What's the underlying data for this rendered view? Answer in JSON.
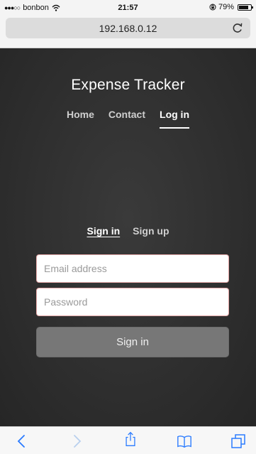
{
  "status_bar": {
    "carrier": "bonbon",
    "signal_dots": "●●●○○",
    "time": "21:57",
    "battery_percent": "79%",
    "battery_level": 0.79
  },
  "browser": {
    "url": "192.168.0.12",
    "reload_icon": "reload-icon",
    "toolbar_icons": [
      "back-chevron-icon",
      "forward-chevron-icon",
      "share-icon",
      "bookmarks-icon",
      "tabs-icon"
    ]
  },
  "site": {
    "brand": "Expense Tracker",
    "nav": [
      "Home",
      "Contact",
      "Log in"
    ],
    "active_nav": "Log in"
  },
  "auth": {
    "tabs": [
      "Sign in",
      "Sign up"
    ],
    "active_tab": "Sign in",
    "email_placeholder": "Email address",
    "email_value": "",
    "password_placeholder": "Password",
    "password_value": "",
    "submit_label": "Sign in"
  },
  "colors": {
    "page_background": "#333333",
    "input_border": "#e4a7a7",
    "button_background": "#777777",
    "toolbar_icon": "#2a7bff"
  }
}
